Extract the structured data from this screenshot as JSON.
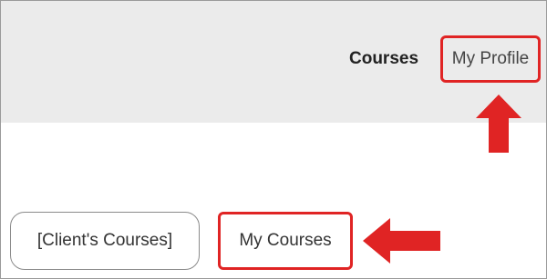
{
  "header": {
    "nav_courses": "Courses",
    "nav_profile": "My Profile"
  },
  "main": {
    "client_courses_button": "[Client's Courses]",
    "my_courses_button": "My Courses"
  },
  "annotations": {
    "highlight_color": "#e02424",
    "arrow_color": "#e02424",
    "header_background": "#ebebeb"
  }
}
